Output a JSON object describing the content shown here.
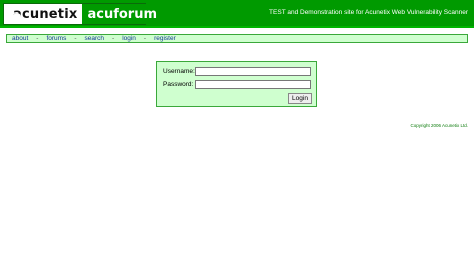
{
  "header": {
    "logo_left": "acunetix",
    "logo_right": "acuforum",
    "tagline": "TEST and Demonstration site for Acunetix Web Vulnerability Scanner"
  },
  "nav": {
    "items": [
      {
        "label": "about"
      },
      {
        "label": "forums"
      },
      {
        "label": "search"
      },
      {
        "label": "login"
      },
      {
        "label": "register"
      }
    ],
    "separator": "-"
  },
  "login_form": {
    "username_label": "Username:",
    "username_value": "",
    "password_label": "Password:",
    "password_value": "",
    "submit_label": "Login"
  },
  "footer": {
    "copyright": "Copyright 2006 Acunetix Ltd."
  },
  "colors": {
    "header_bg": "#009a00",
    "panel_bg": "#cfffcf",
    "panel_border": "#3aa83a",
    "link": "#1a3a9a"
  },
  "icons": {
    "logo": "acunetix-logo-icon"
  }
}
